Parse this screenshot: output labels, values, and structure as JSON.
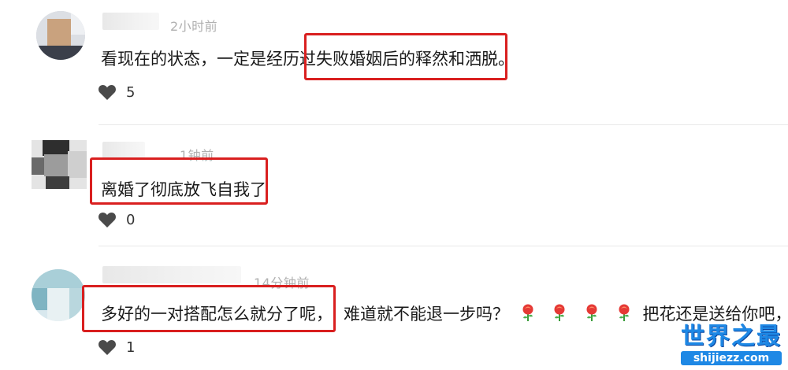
{
  "comments": [
    {
      "time": "2小时前",
      "text": "看现在的状态，一定是经历过失败婚姻后的释然和洒脱。",
      "likes": "5"
    },
    {
      "time": "1钟前",
      "text": "离婚了彻底放飞自我了",
      "likes": "0"
    },
    {
      "time": "14分钟前",
      "text_before": "多好的一对搭配怎么就分了呢，",
      "text_after": "难道就不能退一步吗？",
      "text_end": "把花还是送给你吧，",
      "likes": "1"
    }
  ],
  "icons": {
    "like": "heart-icon",
    "flower": "rose-emoji-icon"
  },
  "colors": {
    "highlight": "#d91f1f",
    "watermark": "#1e88e5"
  },
  "watermark": {
    "title": "世界之最",
    "url": "shijiezz.com"
  }
}
